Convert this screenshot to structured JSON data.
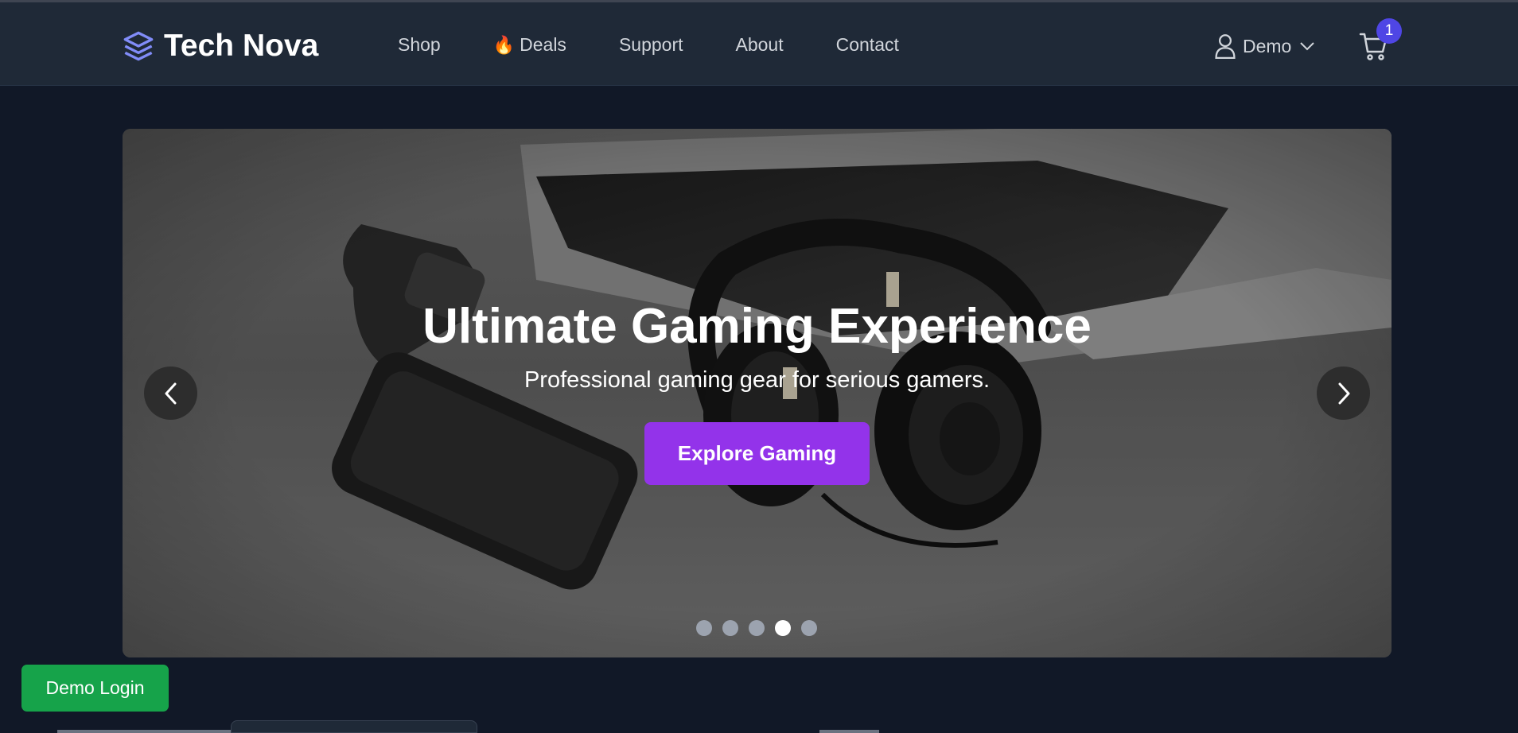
{
  "header": {
    "brand": "Tech Nova",
    "nav": [
      {
        "label": "Shop"
      },
      {
        "label": "Deals",
        "icon": "fire-icon"
      },
      {
        "label": "Support"
      },
      {
        "label": "About"
      },
      {
        "label": "Contact"
      }
    ],
    "user_label": "Demo",
    "cart_count": "1"
  },
  "hero": {
    "title": "Ultimate Gaming Experience",
    "subtitle": "Professional gaming gear for serious gamers.",
    "cta": "Explore Gaming",
    "slide_count": 5,
    "active_slide": 4
  },
  "demo_login": "Demo Login",
  "colors": {
    "background": "#111827",
    "header": "#1f2937",
    "accent_purple": "#9333ea",
    "badge": "#4f46e5",
    "demo_green": "#16a34a"
  }
}
